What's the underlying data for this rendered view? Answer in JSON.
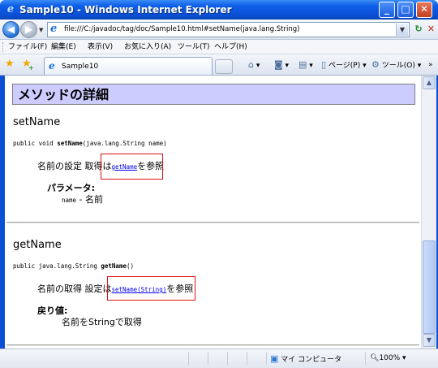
{
  "window": {
    "title": "Sample10 - Windows Internet Explorer",
    "buttons": {
      "minimize": "_",
      "maximize": "□",
      "close": "✕"
    }
  },
  "address_bar": {
    "url": "file:///C:/javadoc/tag/doc/Sample10.html#setName(java.lang.String)"
  },
  "menu": {
    "items": [
      "ファイル(F)",
      "編集(E)",
      "表示(V)",
      "お気に入り(A)",
      "ツール(T)",
      "ヘルプ(H)"
    ]
  },
  "tabs": {
    "active_label": "Sample10"
  },
  "command_bar": {
    "page_label": "ページ(P)",
    "tools_label": "ツール(O)"
  },
  "page": {
    "heading": "メソッドの詳細",
    "methods": [
      {
        "name": "setName",
        "signature_prefix": "public void ",
        "signature_name": "setName",
        "signature_suffix": "(java.lang.String name)",
        "desc_before": "名前の設定 取得は",
        "desc_link": "getName",
        "desc_after": "を参照",
        "section_title": "パラメータ:",
        "param_name": "name",
        "param_desc": " - 名前"
      },
      {
        "name": "getName",
        "signature_prefix": "public java.lang.String ",
        "signature_name": "getName",
        "signature_suffix": "()",
        "desc_before": "名前の取得 設定は",
        "desc_link": "setName(String)",
        "desc_after": "を参照",
        "section_title": "戻り値:",
        "return_desc": "名前をStringで取得"
      }
    ]
  },
  "status_bar": {
    "zone": "マイ コンピュータ",
    "zoom": "100%"
  },
  "colors": {
    "title_bar": "#0a4fd4",
    "heading_bg": "#ccccff",
    "link": "#0000ee",
    "highlight_box": "#e01010"
  }
}
